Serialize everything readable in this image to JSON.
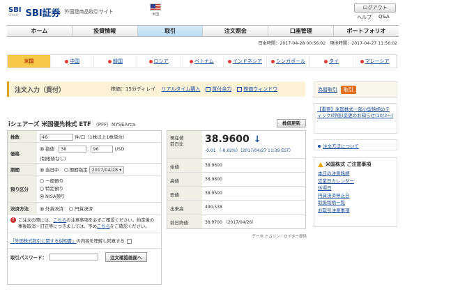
{
  "header": {
    "logo_text": "SBI",
    "logo_sub": "GROUP",
    "brand": "SBI証券",
    "site_name": "外国建商品取引サイト",
    "flag_label": "米国",
    "logout_label": "ログアウト",
    "links": [
      "ヘルプ",
      "Q&A"
    ]
  },
  "main_nav": [
    "ホーム",
    "投資情報",
    "取引",
    "注文照会",
    "口座管理",
    "ポートフォリオ"
  ],
  "main_nav_active": 2,
  "time_info": "日本時間：2017-04-28 00:56:02　現地時間：2017-04-27 11:56:02",
  "market_tabs": [
    {
      "label": "米国",
      "active": true
    },
    {
      "label": "中国"
    },
    {
      "label": "韓国"
    },
    {
      "label": "ロシア"
    },
    {
      "label": "ベトナム"
    },
    {
      "label": "インドネシア"
    },
    {
      "label": "シンガポール"
    },
    {
      "label": "タイ"
    },
    {
      "label": "マレーシア"
    }
  ],
  "order_bar": {
    "title": "注文入力（買付）",
    "delay": "株価：15分ディレイ",
    "realtime": "リアルタイム購入",
    "buying_power": "買付余力",
    "price_window": "株価ウィンドウ"
  },
  "stock": {
    "name": "iシェアーズ 米国優先株式 ETF",
    "code": "（PFF）NYSEArca",
    "refresh_label": "株価更新"
  },
  "form": {
    "qty_label": "株数",
    "qty_value": "46",
    "qty_unit": "件/口（1株以上1株単位）",
    "price_label": "価格",
    "price_type": "指値",
    "price_int": "38",
    "price_dec": "96",
    "price_unit": "USD",
    "price_note": "(制限値なし)",
    "period_label": "期間",
    "period_today": "当日中",
    "period_specified": "期間指定",
    "period_date": "2017/04/28 ▾",
    "account_label": "預り区分",
    "account_options": [
      "一般預り",
      "特定預り",
      "NISA預り"
    ],
    "settle_label": "決済方法",
    "settle_options": [
      "外貨決済",
      "円貨決済"
    ],
    "note_prefix": "ご注文の際には、",
    "note_link1": "こちら",
    "note_mid": "の注意事項を必ずご確認ください。約定後の事後取消・訂正等につきましては、予め",
    "note_link2": "こちら",
    "note_suffix": "をご確認ください。",
    "agree_link": "「外国株式取引に関する説明書」",
    "agree_text": "の内容を理解し同意する",
    "pw_label": "取引パスワード：",
    "confirm_button": "注文確認画面へ"
  },
  "quote": {
    "current_label1": "現在値",
    "current_label2": "前日比",
    "price": "38.9600",
    "change": "-0.01 （-0.02%）（2017/04/27 11:39 EST）",
    "rows": [
      {
        "label": "始値",
        "value": "38.9600"
      },
      {
        "label": "高値",
        "value": "38.9800"
      },
      {
        "label": "安値",
        "value": "38.9500"
      },
      {
        "label": "出来高",
        "value": "490,538"
      },
      {
        "label": "前日終値",
        "value": "38.9700 （2017/04/26）"
      }
    ],
    "source": "データ:トムソン・ロイター提供"
  },
  "right": {
    "fx_label": "為替取引",
    "fx_button": "取引",
    "notice": "【重要】米国株式一部小型銘柄のティック(呼値)変更のお知らせ(10/3～)",
    "howto": "注文方法について",
    "warn_title": "米国株式 ご注意事項",
    "warn_items": [
      "本日の注意銘柄",
      "営業日カレンダー",
      "休場日",
      "円貨決済停止日",
      "取扱銘柄一覧",
      "お取引注意事項"
    ]
  }
}
